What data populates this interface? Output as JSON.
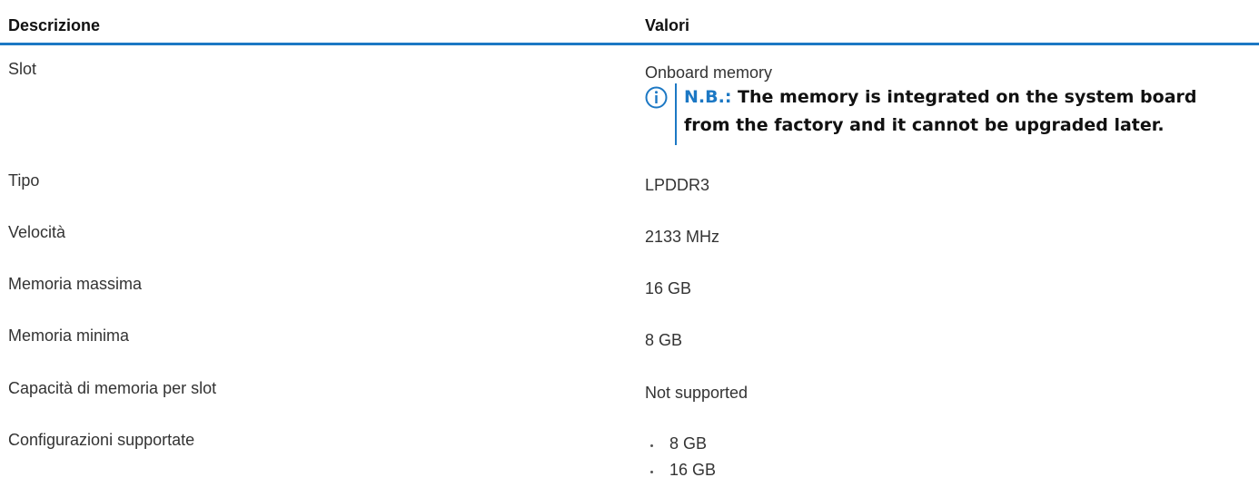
{
  "table": {
    "headers": {
      "description": "Descrizione",
      "values": "Valori"
    },
    "rows": [
      {
        "label": "Slot",
        "value": "Onboard memory",
        "note": {
          "label": "N.B.:",
          "text": "The memory is integrated on the system board from the factory and it cannot be upgraded later."
        }
      },
      {
        "label": "Tipo",
        "value": "LPDDR3"
      },
      {
        "label": "Velocità",
        "value": "2133 MHz"
      },
      {
        "label": "Memoria massima",
        "value": "16 GB"
      },
      {
        "label": "Memoria minima",
        "value": "8 GB"
      },
      {
        "label": "Capacità di memoria per slot",
        "value": "Not supported"
      },
      {
        "label": "Configurazioni supportate",
        "values": [
          "8 GB",
          "16 GB"
        ]
      }
    ]
  },
  "icons": {
    "note": "info-icon"
  },
  "colors": {
    "accent": "#1c78c4",
    "text": "#333333",
    "heading": "#111111"
  }
}
